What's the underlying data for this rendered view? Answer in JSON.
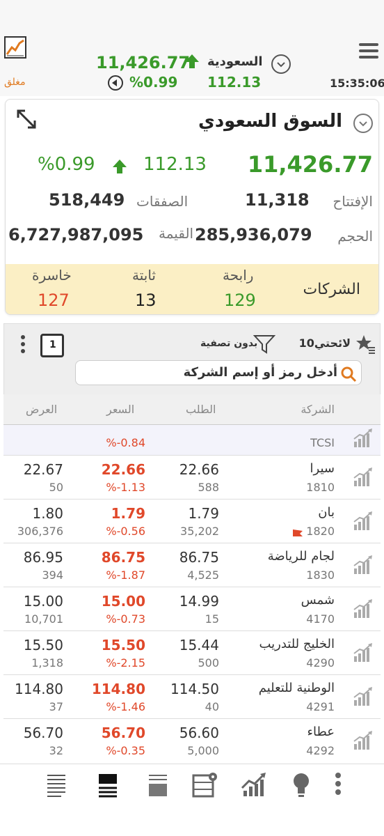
{
  "header": {
    "status": "مغلق",
    "index_value": "11,426.77",
    "market_name": "السعودية",
    "change_pct": "%0.99",
    "change_value": "112.13",
    "time": "15:35:06"
  },
  "market": {
    "title": "السوق السعودي",
    "index_value": "11,426.77",
    "change_value": "112.13",
    "change_pct": "%0.99",
    "open_label": "الإفتتاح",
    "open_value": "11,318",
    "deals_label": "الصفقات",
    "deals_value": "518,449",
    "volume_label": "الحجم",
    "volume_value": "285,936,079",
    "value_label": "القيمة",
    "value_value": "6,727,987,095",
    "companies_label": "الشركات",
    "gainers_label": "رابحة",
    "gainers_value": "129",
    "unchanged_label": "ثابتة",
    "unchanged_value": "13",
    "losers_label": "خاسرة",
    "losers_value": "127"
  },
  "watchlist": {
    "name": "لائحتي10",
    "filter_label": "بدون تصفية",
    "calendar_day": "1",
    "search_placeholder": "أدخل رمز أو إسم الشركة",
    "columns": {
      "company": "الشركة",
      "bid": "الطلب",
      "price": "السعر",
      "ask": "العرض"
    },
    "first_row": {
      "code": "TCSI",
      "pct": "%-0.84"
    },
    "rows": [
      {
        "name": "سيرا",
        "code": "1810",
        "bid": "22.66",
        "bid_qty": "588",
        "price": "22.66",
        "pct": "%-1.13",
        "ask": "22.67",
        "ask_qty": "50"
      },
      {
        "name": "بان",
        "code": "1820",
        "bid": "1.79",
        "bid_qty": "35,202",
        "price": "1.79",
        "pct": "%-0.56",
        "ask": "1.80",
        "ask_qty": "306,376"
      },
      {
        "name": "لجام للرياضة",
        "code": "1830",
        "bid": "86.75",
        "bid_qty": "4,525",
        "price": "86.75",
        "pct": "%-1.87",
        "ask": "86.95",
        "ask_qty": "394"
      },
      {
        "name": "شمس",
        "code": "4170",
        "bid": "14.99",
        "bid_qty": "15",
        "price": "15.00",
        "pct": "%-0.73",
        "ask": "15.00",
        "ask_qty": "10,701"
      },
      {
        "name": "الخليج للتدريب",
        "code": "4290",
        "bid": "15.44",
        "bid_qty": "500",
        "price": "15.50",
        "pct": "%-2.15",
        "ask": "15.50",
        "ask_qty": "1,318"
      },
      {
        "name": "الوطنية للتعليم",
        "code": "4291",
        "bid": "114.50",
        "bid_qty": "40",
        "price": "114.80",
        "pct": "%-1.46",
        "ask": "114.80",
        "ask_qty": "37"
      },
      {
        "name": "عطاء",
        "code": "4292",
        "bid": "56.60",
        "bid_qty": "5,000",
        "price": "56.70",
        "pct": "%-0.35",
        "ask": "56.70",
        "ask_qty": "32"
      }
    ]
  },
  "colors": {
    "up": "#3a9a2a",
    "down": "#e0482a",
    "closed": "#e07a20",
    "stats_bg": "#fbefc5"
  },
  "icons": [
    "app-chart-logo-icon",
    "chevron-down-icon",
    "arrow-up-icon",
    "back-arrow-icon",
    "hamburger-menu-icon",
    "expand-icon",
    "star-list-icon",
    "filter-icon",
    "calendar-icon",
    "more-vertical-icon",
    "search-icon",
    "stock-chart-icon",
    "flag-icon"
  ]
}
